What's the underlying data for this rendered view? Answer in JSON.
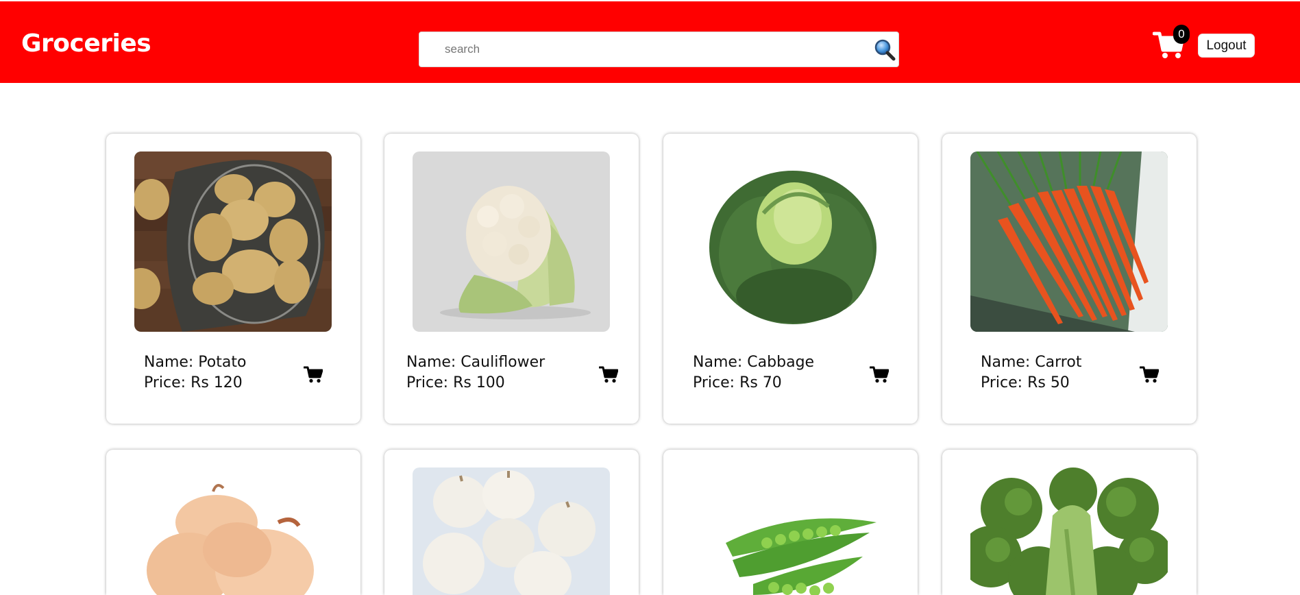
{
  "navbar": {
    "brand": "Groceries",
    "search_placeholder": "search",
    "search_icon": "magnifier-icon",
    "cart_icon": "shopping-cart-icon",
    "cart_count": "0",
    "logout_label": "Logout",
    "colors": {
      "background": "#ff0000",
      "text": "#ffffff"
    }
  },
  "products": [
    {
      "name_label": "Name: Potato",
      "price_label": "Price: Rs 120",
      "image": "potato-photo"
    },
    {
      "name_label": "Name: Cauliflower",
      "price_label": "Price: Rs 100",
      "image": "cauliflower-photo"
    },
    {
      "name_label": "Name: Cabbage",
      "price_label": "Price: Rs 70",
      "image": "cabbage-photo"
    },
    {
      "name_label": "Name: Carrot",
      "price_label": "Price: Rs 50",
      "image": "carrot-photo"
    },
    {
      "image": "onion-photo"
    },
    {
      "image": "garlic-photo"
    },
    {
      "image": "green-peas-photo"
    },
    {
      "image": "broccoli-photo"
    }
  ],
  "add_to_cart_icon": "cart-icon"
}
